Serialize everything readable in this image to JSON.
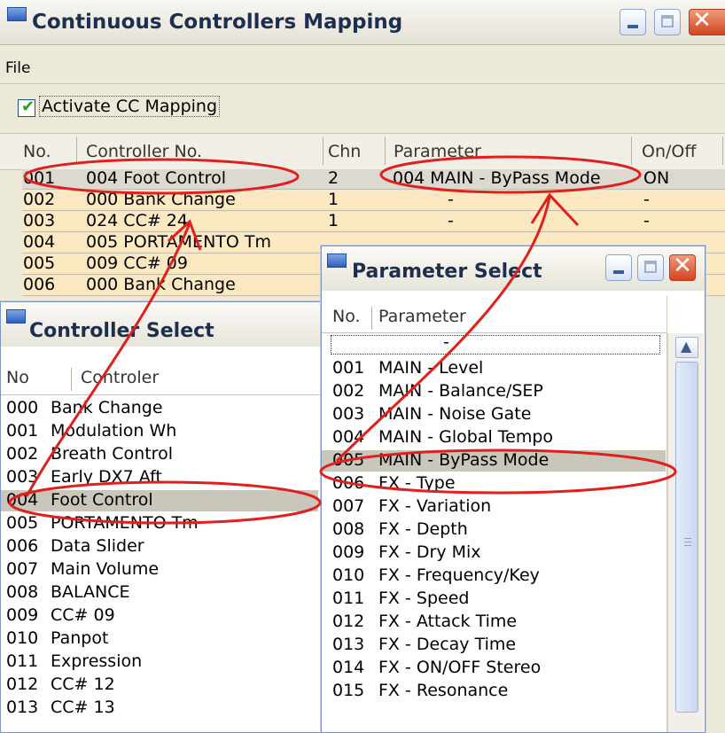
{
  "main_window": {
    "title": "Continuous Controllers Mapping",
    "menu": [
      "File"
    ],
    "activate_label": "Activate CC Mapping",
    "activate_checked": true,
    "columns": [
      "No.",
      "Controller No.",
      "Chn",
      "Parameter",
      "On/Off"
    ],
    "rows": [
      {
        "no": "001",
        "controller": "004 Foot Control",
        "chn": "2",
        "param": "004 MAIN - ByPass Mode",
        "onoff": "ON"
      },
      {
        "no": "002",
        "controller": "000 Bank Change",
        "chn": "1",
        "param": "-",
        "onoff": "-"
      },
      {
        "no": "003",
        "controller": "024 CC# 24",
        "chn": "1",
        "param": "-",
        "onoff": "-"
      },
      {
        "no": "004",
        "controller": "005 PORTAMENTO Tm",
        "chn": "",
        "param": "",
        "onoff": ""
      },
      {
        "no": "005",
        "controller": "009 CC# 09",
        "chn": "",
        "param": "",
        "onoff": ""
      },
      {
        "no": "006",
        "controller": "000 Bank Change",
        "chn": "",
        "param": "",
        "onoff": ""
      }
    ]
  },
  "controller_select": {
    "title": "Controller Select",
    "columns": [
      "No",
      "Controler"
    ],
    "items": [
      {
        "no": "000",
        "name": "Bank Change"
      },
      {
        "no": "001",
        "name": "Modulation Wh"
      },
      {
        "no": "002",
        "name": "Breath Control"
      },
      {
        "no": "003",
        "name": "Early DX7 Aft"
      },
      {
        "no": "004",
        "name": "Foot Control"
      },
      {
        "no": "005",
        "name": "PORTAMENTO Tm"
      },
      {
        "no": "006",
        "name": "Data Slider"
      },
      {
        "no": "007",
        "name": "Main Volume"
      },
      {
        "no": "008",
        "name": "BALANCE"
      },
      {
        "no": "009",
        "name": "CC# 09"
      },
      {
        "no": "010",
        "name": "Panpot"
      },
      {
        "no": "011",
        "name": "Expression"
      },
      {
        "no": "012",
        "name": "CC# 12"
      },
      {
        "no": "013",
        "name": "CC# 13"
      }
    ],
    "selected_index": 4
  },
  "parameter_select": {
    "title": "Parameter Select",
    "columns": [
      "No.",
      "Parameter"
    ],
    "first_item": "-",
    "items": [
      {
        "no": "001",
        "name": "MAIN - Level"
      },
      {
        "no": "002",
        "name": "MAIN - Balance/SEP"
      },
      {
        "no": "003",
        "name": "MAIN - Noise Gate"
      },
      {
        "no": "004",
        "name": "MAIN - Global Tempo"
      },
      {
        "no": "005",
        "name": "MAIN - ByPass Mode"
      },
      {
        "no": "006",
        "name": "FX - Type"
      },
      {
        "no": "007",
        "name": "FX - Variation"
      },
      {
        "no": "008",
        "name": "FX - Depth"
      },
      {
        "no": "009",
        "name": "FX - Dry Mix"
      },
      {
        "no": "010",
        "name": "FX - Frequency/Key"
      },
      {
        "no": "011",
        "name": "FX - Speed"
      },
      {
        "no": "012",
        "name": "FX - Attack Time"
      },
      {
        "no": "013",
        "name": "FX - Decay Time"
      },
      {
        "no": "014",
        "name": "FX - ON/OFF Stereo"
      },
      {
        "no": "015",
        "name": "FX - Resonance"
      }
    ],
    "selected_index": 4
  },
  "icons": {
    "minimize": "minimize-icon",
    "maximize": "maximize-icon",
    "close": "close-icon",
    "window": "window-app-icon",
    "scroll_up": "chevron-up-icon"
  },
  "colors": {
    "row_fill": "#fde9c1",
    "selected_fill": "#c9c6bc",
    "annotation": "#e0201c"
  }
}
